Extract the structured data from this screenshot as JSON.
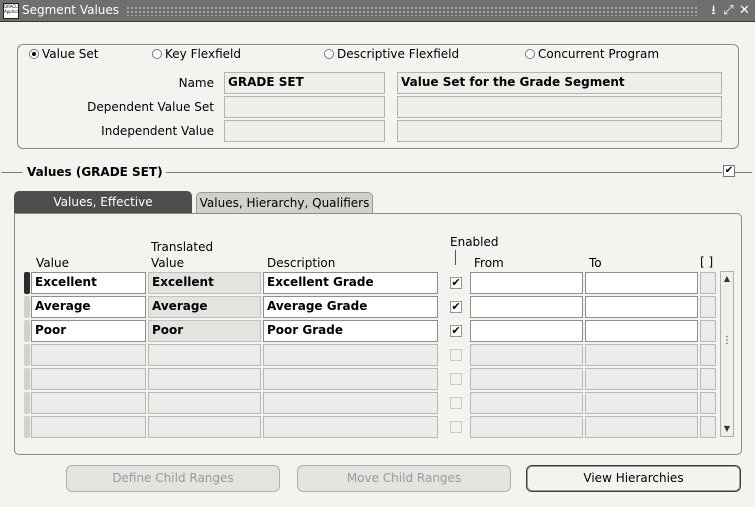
{
  "window": {
    "title": "Segment Values",
    "app_icon_text": "ORACLE Applications",
    "controls": {
      "minimize": "⭳",
      "maximize": "⤢",
      "close": "✕"
    }
  },
  "source": {
    "options": [
      {
        "label": "Value Set",
        "selected": true
      },
      {
        "label": "Key Flexfield",
        "selected": false
      },
      {
        "label": "Descriptive Flexfield",
        "selected": false
      },
      {
        "label": "Concurrent Program",
        "selected": false
      }
    ],
    "name_label": "Name",
    "name_value": "GRADE SET",
    "name_description": "Value Set for the Grade Segment",
    "dependent_label": "Dependent Value Set",
    "dependent_value": "",
    "dependent_description": "",
    "independent_label": "Independent Value",
    "independent_value": "",
    "independent_description": ""
  },
  "values_section": {
    "title": "Values (GRADE SET)",
    "checked": true,
    "check_mark": "✔"
  },
  "tabs": [
    {
      "label": "Values, Effective",
      "active": true
    },
    {
      "label": "Values, Hierarchy, Qualifiers",
      "active": false
    }
  ],
  "table": {
    "headers": {
      "value": "Value",
      "translated_top": "Translated",
      "translated_bottom": "Value",
      "description": "Description",
      "enabled": "Enabled",
      "from": "From",
      "to": "To",
      "dff": "[ ]"
    },
    "rows": [
      {
        "value": "Excellent",
        "translated": "Excellent",
        "description": "Excellent Grade",
        "enabled": true,
        "from": "",
        "to": ""
      },
      {
        "value": "Average",
        "translated": "Average",
        "description": "Average Grade",
        "enabled": true,
        "from": "",
        "to": ""
      },
      {
        "value": "Poor",
        "translated": "Poor",
        "description": "Poor Grade",
        "enabled": true,
        "from": "",
        "to": ""
      },
      {
        "value": "",
        "translated": "",
        "description": "",
        "enabled": false,
        "from": "",
        "to": ""
      },
      {
        "value": "",
        "translated": "",
        "description": "",
        "enabled": false,
        "from": "",
        "to": ""
      },
      {
        "value": "",
        "translated": "",
        "description": "",
        "enabled": false,
        "from": "",
        "to": ""
      },
      {
        "value": "",
        "translated": "",
        "description": "",
        "enabled": false,
        "from": "",
        "to": ""
      }
    ],
    "scroll_up": "▲",
    "scroll_down": "▼",
    "scroll_grip": "⋮"
  },
  "buttons": {
    "define_child_ranges": "Define Child Ranges",
    "move_child_ranges": "Move Child Ranges",
    "view_hierarchies": "View Hierarchies"
  },
  "colors": {
    "titlebar": "#6f6f6f",
    "active_tab": "#4e4e4e",
    "background": "#f3f3ef"
  }
}
